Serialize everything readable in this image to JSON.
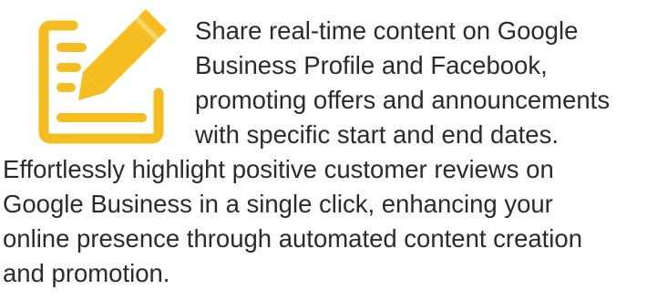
{
  "feature": {
    "icon": "document-edit-icon",
    "accent_color": "#F5BD1F",
    "text_color": "#2b2b2b",
    "intro_text": "Share real-time content on Google\nBusiness Profile and Facebook,\npromoting offers and announcements\nwith specific start and end dates.",
    "body_text": "Effortlessly highlight positive customer reviews on\nGoogle Business in a single click, enhancing your\nonline presence through automated content creation\nand promotion."
  }
}
